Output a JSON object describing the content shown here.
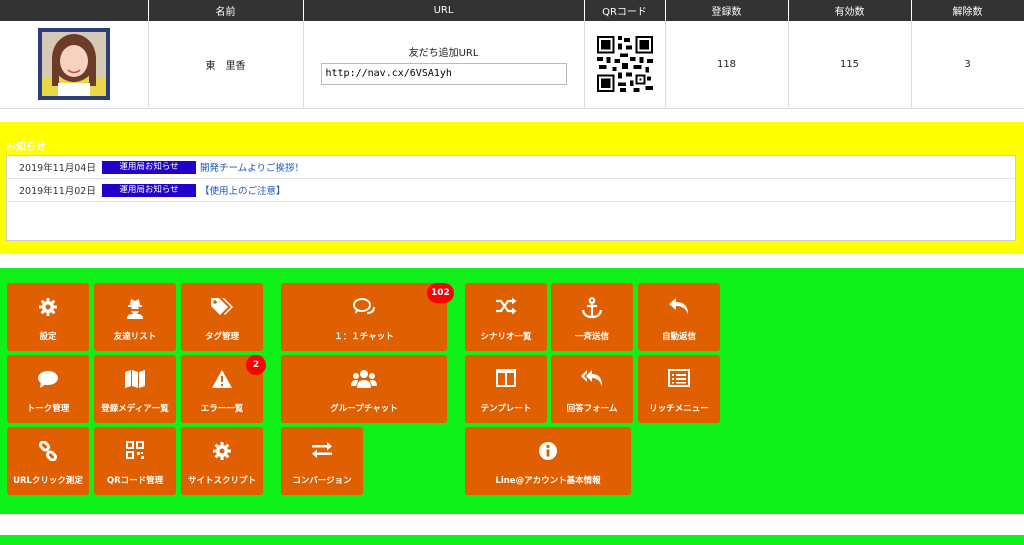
{
  "account_table": {
    "headers": [
      "",
      "名前",
      "URL",
      "QRコード",
      "登録数",
      "有効数",
      "解除数"
    ],
    "name": "東　里香",
    "url_label": "友だち追加URL",
    "url_value": "http://nav.cx/6VSA1yh",
    "registered": "118",
    "active": "115",
    "canceled": "3"
  },
  "notices": {
    "title": "お知らせ",
    "items": [
      {
        "date": "2019年11月04日",
        "badge": "運用局お知らせ",
        "text": "開発チームよりご挨拶！"
      },
      {
        "date": "2019年11月02日",
        "badge": "運用局お知らせ",
        "text": "【使用上のご注意】"
      }
    ]
  },
  "menu": {
    "settings": {
      "label": "設定",
      "icon": "gear-icon"
    },
    "friends": {
      "label": "友達リスト",
      "icon": "user-secret-icon"
    },
    "tags": {
      "label": "タグ管理",
      "icon": "tags-icon"
    },
    "chat": {
      "label": "１：１チャット",
      "icon": "chat-bubbles-icon",
      "badge": "102"
    },
    "scenario": {
      "label": "シナリオ一覧",
      "icon": "shuffle-icon"
    },
    "broadcast": {
      "label": "一斉送信",
      "icon": "anchor-icon"
    },
    "autoreply": {
      "label": "自動返信",
      "icon": "reply-icon"
    },
    "talk": {
      "label": "トーク管理",
      "icon": "speech-bubble-icon"
    },
    "media": {
      "label": "登録メディア一覧",
      "icon": "map-icon"
    },
    "errors": {
      "label": "エラー一覧",
      "icon": "warning-icon",
      "badge": "2"
    },
    "group_chat": {
      "label": "グループチャット",
      "icon": "users-icon"
    },
    "template": {
      "label": "テンプレート",
      "icon": "columns-icon"
    },
    "answer_form": {
      "label": "回答フォーム",
      "icon": "reply-all-icon"
    },
    "rich_menu": {
      "label": "リッチメニュー",
      "icon": "list-alt-icon"
    },
    "url_click": {
      "label": "URLクリック測定",
      "icon": "link-icon"
    },
    "qr_manage": {
      "label": "QRコード管理",
      "icon": "qrcode-icon"
    },
    "site_script": {
      "label": "サイトスクリプト",
      "icon": "gear-icon"
    },
    "conversion": {
      "label": "コンバージョン",
      "icon": "exchange-icon"
    },
    "line_account": {
      "label": "Line@アカウント基本情報",
      "icon": "info-icon"
    }
  },
  "colors": {
    "header_bg": "#333333",
    "notice_bg": "#ffff00",
    "menu_bg": "#0ff01a",
    "button": "#e05f00",
    "badge": "#ff0000",
    "notice_badge": "#2200cc"
  }
}
